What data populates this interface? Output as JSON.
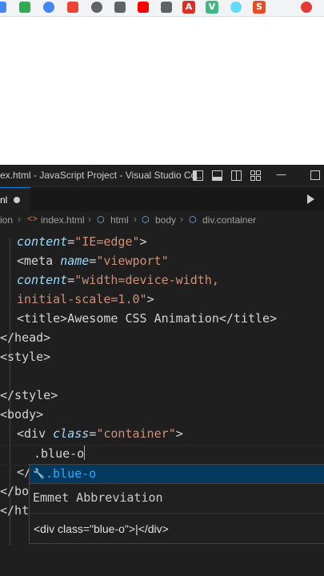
{
  "window": {
    "title": "ex.html - JavaScript Project - Visual Studio Co..."
  },
  "bookmarks": [
    {
      "name": "bookmark-icon-1",
      "color": "#4285f4"
    },
    {
      "name": "bookmark-icon-2",
      "color": "#34a853"
    },
    {
      "name": "bookmark-icon-3",
      "color": "#4285f4"
    },
    {
      "name": "bookmark-icon-4",
      "color": "#ea4335"
    },
    {
      "name": "bookmark-icon-5",
      "color": "#5f6368"
    },
    {
      "name": "bookmark-icon-6",
      "color": "#5f6368"
    },
    {
      "name": "bookmark-icon-7",
      "color": "#ff0000"
    },
    {
      "name": "bookmark-icon-8",
      "color": "#5f6368"
    },
    {
      "name": "bookmark-icon-9",
      "color": "#d93025"
    },
    {
      "name": "bookmark-icon-10",
      "color": "#41b883"
    },
    {
      "name": "bookmark-icon-11",
      "color": "#61dafb"
    },
    {
      "name": "bookmark-icon-12",
      "color": "#e44d26"
    },
    {
      "name": "bookmark-icon-13",
      "color": "#e53935"
    }
  ],
  "bookmark_letters": {
    "a": "A",
    "v": "V",
    "s": "S"
  },
  "tab": {
    "label": "nl",
    "modified": true
  },
  "breadcrumb": {
    "root": "ion",
    "file": "index.html",
    "html": "html",
    "body": "body",
    "container": "div.container"
  },
  "code": {
    "l1_attr": "content",
    "l1_val": "\"IE=edge\"",
    "l1_end": ">",
    "l2_open": "<meta",
    "l2_attr": "name",
    "l2_val": "\"viewport\"",
    "l3_attr": "content",
    "l3_val": "\"width=device-width,",
    "l4_val": "initial-scale=1.0\"",
    "l4_end": ">",
    "l5_open": "<title>",
    "l5_text": "Awesome CSS Animation",
    "l5_close": "</title>",
    "l6": "</head>",
    "l7": "<style>",
    "l9": "</style>",
    "l10": "<body>",
    "l11_open": "<div",
    "l11_attr": "class",
    "l11_val": "\"container\"",
    "l11_end": ">",
    "l12": ".blue-o",
    "l13_partial": "</",
    "l14_partial": "</bo",
    "l15_partial": "</ht"
  },
  "suggest": {
    "item": ".blue-o",
    "detail_title": "Emmet Abbreviation",
    "detail_code": "<div class=\"blue-o\">|</div>"
  },
  "colors": {
    "editor_bg": "#1f1f1f",
    "attr": "#9cdcfe",
    "string": "#ce9178",
    "suggest_highlight": "#2aaaff",
    "accent": "#0078d4"
  }
}
